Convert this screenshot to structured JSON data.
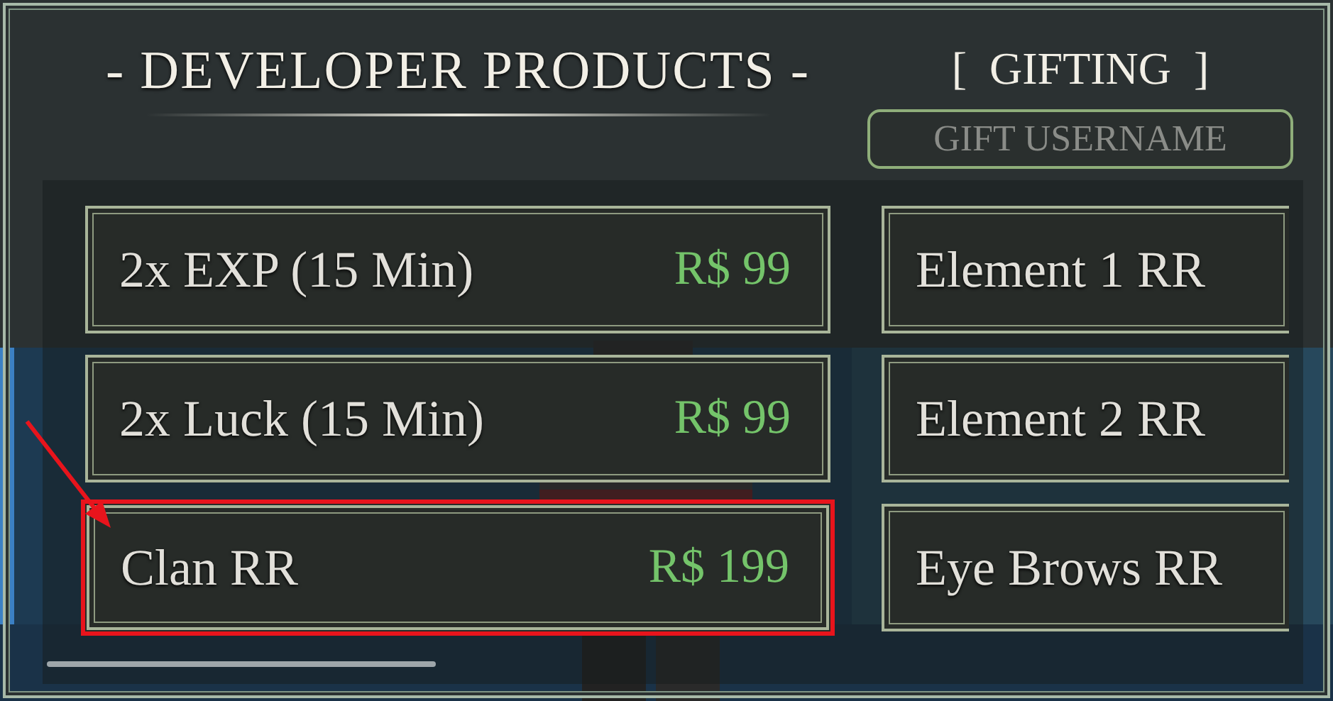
{
  "title": "- DEVELOPER PRODUCTS -",
  "gifting": {
    "label": "[  GIFTING  ]",
    "field": {
      "placeholder": "GIFT USERNAME"
    }
  },
  "products": [
    {
      "name": "2x EXP (15 Min)",
      "price": "R$ 99",
      "highlighted": false
    },
    {
      "name": "2x Luck (15 Min)",
      "price": "R$ 99",
      "highlighted": false
    },
    {
      "name": "Clan RR",
      "price": "R$ 199",
      "highlighted": true
    }
  ],
  "gift_items": [
    {
      "name": "Element 1 RR"
    },
    {
      "name": "Element 2 RR"
    },
    {
      "name": "Eye Brows RR"
    }
  ]
}
